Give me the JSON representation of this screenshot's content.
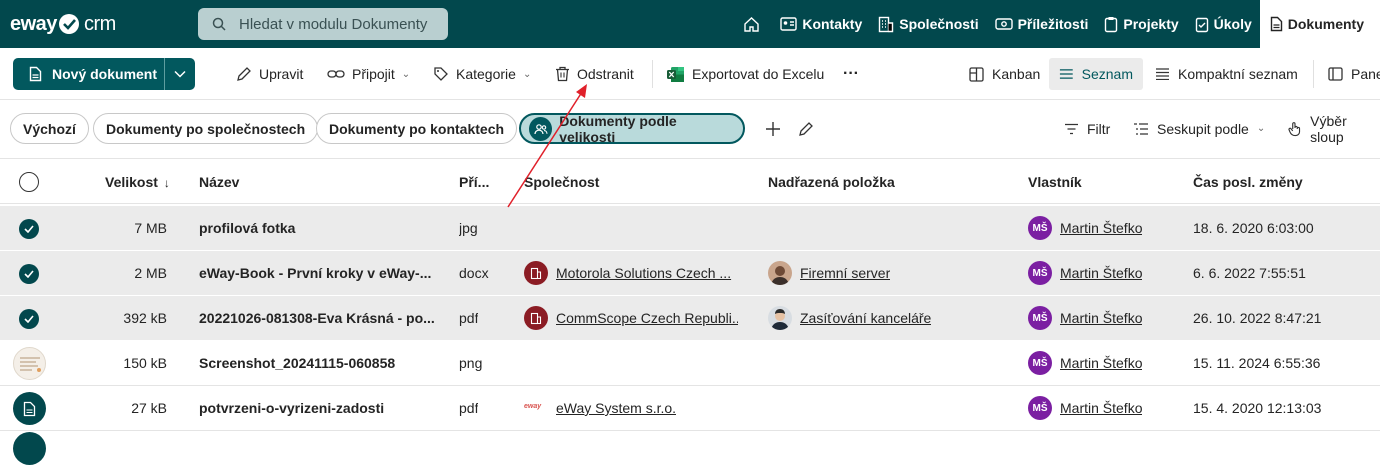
{
  "app": {
    "logo_main": "eway",
    "logo_suffix": "crm"
  },
  "search": {
    "placeholder": "Hledat v modulu Dokumenty"
  },
  "nav": [
    {
      "label": "Kontakty"
    },
    {
      "label": "Společnosti"
    },
    {
      "label": "Příležitosti"
    },
    {
      "label": "Projekty"
    },
    {
      "label": "Úkoly"
    },
    {
      "label": "Dokumenty"
    }
  ],
  "toolbar": {
    "new_document": "Nový dokument",
    "edit": "Upravit",
    "attach": "Připojit",
    "category": "Kategorie",
    "delete": "Odstranit",
    "export": "Exportovat do Excelu",
    "more": "···",
    "kanban": "Kanban",
    "list": "Seznam",
    "compact_list": "Kompaktní seznam",
    "panel": "Pane"
  },
  "views": {
    "default": "Výchozí",
    "by_company": "Dokumenty po společnostech",
    "by_contact": "Dokumenty po kontaktech",
    "by_size": "Dokumenty podle velikosti",
    "filter": "Filtr",
    "group_by": "Seskupit podle",
    "column_select": "Výběr sloup"
  },
  "table": {
    "headers": {
      "size": "Velikost",
      "sort_indicator": "↓",
      "name": "Název",
      "ext": "Pří...",
      "company": "Společnost",
      "parent": "Nadřazená položka",
      "owner": "Vlastník",
      "modified": "Čas posl. změny"
    },
    "rows": [
      {
        "size": "7 MB",
        "name": "profilová fotka",
        "ext": "jpg",
        "company": "",
        "parent": "",
        "owner_initials": "MŠ",
        "owner": "Martin Štefko",
        "modified": "18. 6. 2020 6:03:00"
      },
      {
        "size": "2 MB",
        "name": "eWay-Book - První kroky v eWay-...",
        "ext": "docx",
        "company": "Motorola Solutions Czech ...",
        "parent": "Firemní server",
        "owner_initials": "MŠ",
        "owner": "Martin Štefko",
        "modified": "6. 6. 2022 7:55:51"
      },
      {
        "size": "392 kB",
        "name": "20221026-081308-Eva Krásná - po...",
        "ext": "pdf",
        "company": "CommScope Czech Republi...",
        "parent": "Zasíťování kanceláře",
        "owner_initials": "MŠ",
        "owner": "Martin Štefko",
        "modified": "26. 10. 2022 8:47:21"
      },
      {
        "size": "150 kB",
        "name": "Screenshot_20241115-060858",
        "ext": "png",
        "company": "",
        "parent": "",
        "owner_initials": "MŠ",
        "owner": "Martin Štefko",
        "modified": "15. 11. 2024 6:55:36"
      },
      {
        "size": "27 kB",
        "name": "potvrzeni-o-vyrizeni-zadosti",
        "ext": "pdf",
        "company": "eWay System s.r.o.",
        "company_logo_text": "eway",
        "parent": "",
        "owner_initials": "MŠ",
        "owner": "Martin Štefko",
        "modified": "15. 4. 2020 12:13:03"
      }
    ]
  },
  "colors": {
    "brand": "#02484d",
    "accent": "#02585e",
    "selected_row": "#ebebeb",
    "owner_avatar": "#7b1fa2",
    "annotation_arrow": "#e0202a"
  }
}
